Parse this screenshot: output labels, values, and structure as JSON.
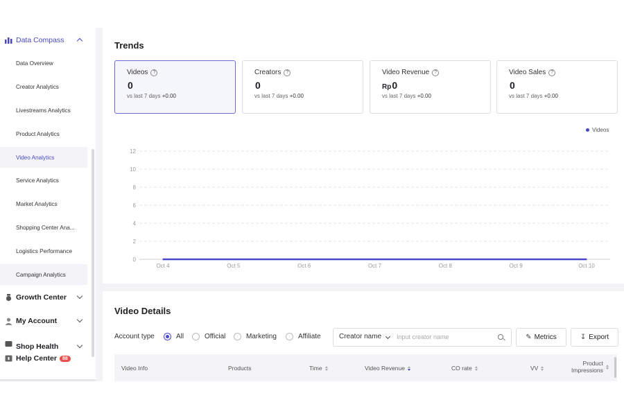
{
  "sidebar": {
    "data_compass": "Data Compass",
    "items": [
      {
        "label": "Data Overview"
      },
      {
        "label": "Creator Analytics"
      },
      {
        "label": "Livestreams Analytics"
      },
      {
        "label": "Product Analytics"
      },
      {
        "label": "Video Analytics"
      },
      {
        "label": "Service Analytics"
      },
      {
        "label": "Market Analytics"
      },
      {
        "label": "Shopping Center Ana..."
      },
      {
        "label": "Logistics Performance"
      },
      {
        "label": "Campaign Analytics"
      }
    ],
    "growth_center": "Growth Center",
    "my_account": "My Account",
    "shop_health": "Shop Health",
    "help_center": "Help Center",
    "help_badge": "88"
  },
  "trends": {
    "title": "Trends",
    "cards": [
      {
        "label": "Videos",
        "prefix": "",
        "value": "0",
        "compare": "vs last 7 days",
        "delta": "+0.00"
      },
      {
        "label": "Creators",
        "prefix": "",
        "value": "0",
        "compare": "vs last 7 days",
        "delta": "+0.00"
      },
      {
        "label": "Video Revenue",
        "prefix": "Rp",
        "value": "0",
        "compare": "vs last 7 days",
        "delta": "+0.00"
      },
      {
        "label": "Video Sales",
        "prefix": "",
        "value": "0",
        "compare": "vs last 7 days",
        "delta": "+0.00"
      }
    ],
    "legend": "Videos"
  },
  "chart_data": {
    "type": "line",
    "x": [
      "Oct 4",
      "Oct 5",
      "Oct 6",
      "Oct 7",
      "Oct 8",
      "Oct 9",
      "Oct 10"
    ],
    "series": [
      {
        "name": "Videos",
        "values": [
          0,
          0,
          0,
          0,
          0,
          0,
          0
        ]
      }
    ],
    "yticks": [
      0,
      2,
      4,
      6,
      8,
      10,
      12
    ],
    "ylim": [
      0,
      12
    ],
    "grid": true,
    "legend": "top-right",
    "color": "#4a48c9"
  },
  "details": {
    "title": "Video Details",
    "account_type_label": "Account type",
    "options": [
      "All",
      "Official",
      "Marketing",
      "Affiliate"
    ],
    "selected": "All",
    "search_select": "Creator name",
    "search_placeholder": "Input creator name",
    "metrics_label": "Metrics",
    "export_label": "Export",
    "columns": [
      "Video Info",
      "Products",
      "Time",
      "Video Revenue",
      "CO rate",
      "VV",
      "Product",
      "Impressions"
    ]
  }
}
